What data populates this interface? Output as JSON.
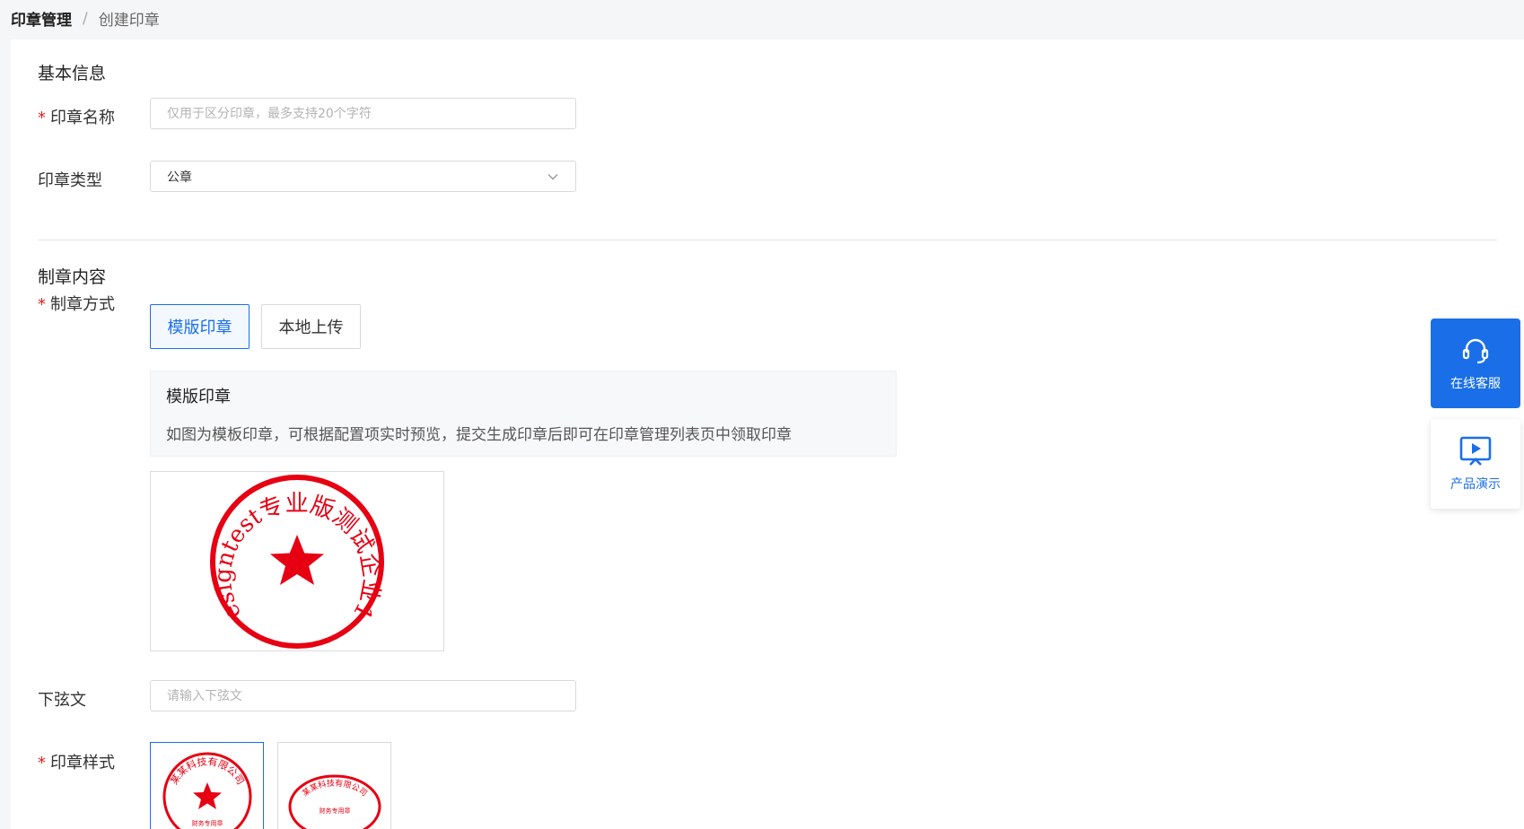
{
  "breadcrumb": {
    "parent": "印章管理",
    "separator": "/",
    "current": "创建印章"
  },
  "basic": {
    "section_title": "基本信息",
    "name_label": "印章名称",
    "name_placeholder": "仅用于区分印章，最多支持20个字符",
    "type_label": "印章类型",
    "type_value": "公章"
  },
  "content": {
    "section_title": "制章内容",
    "method_label": "制章方式",
    "methods": [
      "模版印章",
      "本地上传"
    ],
    "info_title": "模版印章",
    "info_desc": "如图为模板印章，可根据配置项实时预览，提交生成印章后即可在印章管理列表页中领取印章",
    "preview_text": "esigntest专业版测试企业1",
    "lower_label": "下弦文",
    "lower_placeholder": "请输入下弦文",
    "style_label": "印章样式",
    "style_round_text": "某某科技有限公司",
    "style_round_sub": "财务专用章",
    "style_oval_text": "某某科技有限公司",
    "style_oval_sub": "财务专用章"
  },
  "side": {
    "service_label": "在线客服",
    "demo_label": "产品演示"
  },
  "colors": {
    "accent": "#1a6fe8",
    "seal_red": "#e60012",
    "required": "#e02020"
  }
}
